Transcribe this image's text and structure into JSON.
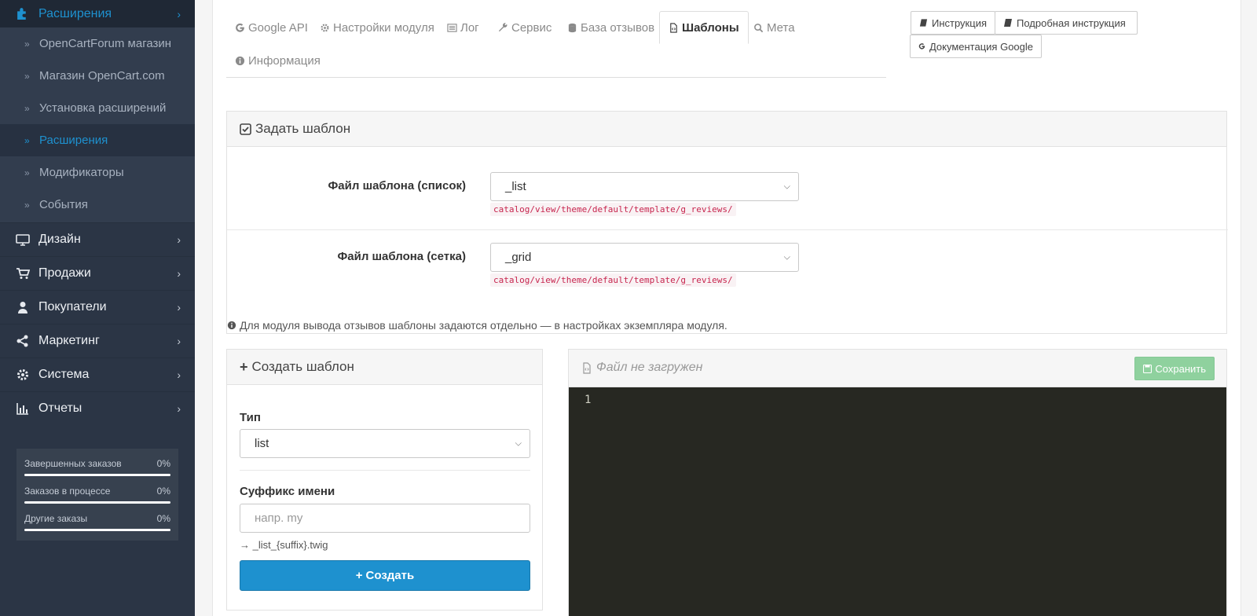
{
  "sidebar": {
    "active_parent": {
      "label": "Расширения",
      "icon": "puzzle-icon"
    },
    "sub_items": [
      {
        "label": "OpenCartForum магазин",
        "active": false
      },
      {
        "label": "Магазин OpenCart.com",
        "active": false
      },
      {
        "label": "Установка расширений",
        "active": false
      },
      {
        "label": "Расширения",
        "active": true
      },
      {
        "label": "Модификаторы",
        "active": false
      },
      {
        "label": "События",
        "active": false
      }
    ],
    "main_items": [
      {
        "label": "Дизайн",
        "icon": "desktop-icon"
      },
      {
        "label": "Продажи",
        "icon": "cart-icon"
      },
      {
        "label": "Покупатели",
        "icon": "user-icon"
      },
      {
        "label": "Маркетинг",
        "icon": "share-icon"
      },
      {
        "label": "Система",
        "icon": "gear-icon"
      },
      {
        "label": "Отчеты",
        "icon": "bar-chart-icon"
      }
    ],
    "progress": [
      {
        "label": "Завершенных заказов",
        "value": "0%",
        "fraction": 0
      },
      {
        "label": "Заказов в процессе",
        "value": "0%",
        "fraction": 0
      },
      {
        "label": "Другие заказы",
        "value": "0%",
        "fraction": 0
      }
    ]
  },
  "tabs": [
    {
      "label": "Google API",
      "icon": "google-icon",
      "active": false
    },
    {
      "label": "Настройки модуля",
      "icon": "gear-icon",
      "active": false
    },
    {
      "label": "Лог",
      "icon": "list-icon",
      "active": false
    },
    {
      "label": "Сервис",
      "icon": "wrench-icon",
      "active": false
    },
    {
      "label": "База отзывов",
      "icon": "database-icon",
      "active": false
    },
    {
      "label": "Шаблоны",
      "icon": "code-file-icon",
      "active": true
    },
    {
      "label": "Мета",
      "icon": "search-icon",
      "active": false
    },
    {
      "label": "Информация",
      "icon": "info-icon",
      "active": false
    }
  ],
  "doc_buttons": [
    {
      "label": "Инструкция",
      "icon": "book-icon"
    },
    {
      "label": "Подробная инструкция",
      "icon": "book-icon"
    },
    {
      "label": "Документация Google",
      "icon": "google-icon"
    }
  ],
  "set_template": {
    "title": "Задать шаблон",
    "list_label": "Файл шаблона (список)",
    "list_value": "_list",
    "list_path": "catalog/view/theme/default/template/g_reviews/",
    "grid_label": "Файл шаблона (сетка)",
    "grid_value": "_grid",
    "grid_path": "catalog/view/theme/default/template/g_reviews/",
    "note": "Для модуля вывода отзывов шаблоны задаются отдельно — в настройках экземпляра модуля."
  },
  "create_template": {
    "title": "Создать шаблон",
    "type_label": "Тип",
    "type_value": "list",
    "suffix_label": "Суффикс имени",
    "suffix_placeholder": "напр. my",
    "suffix_hint": "→ _list_{suffix}.twig",
    "create_button": "Создать"
  },
  "editor": {
    "title": "Файл не загружен",
    "save_button": "Сохранить",
    "line_number": "1"
  },
  "colors": {
    "sidebar_bg": "#2b3545",
    "accent": "#1e91cf",
    "editor_bg": "#272822",
    "save_button": "#8fd19e"
  }
}
